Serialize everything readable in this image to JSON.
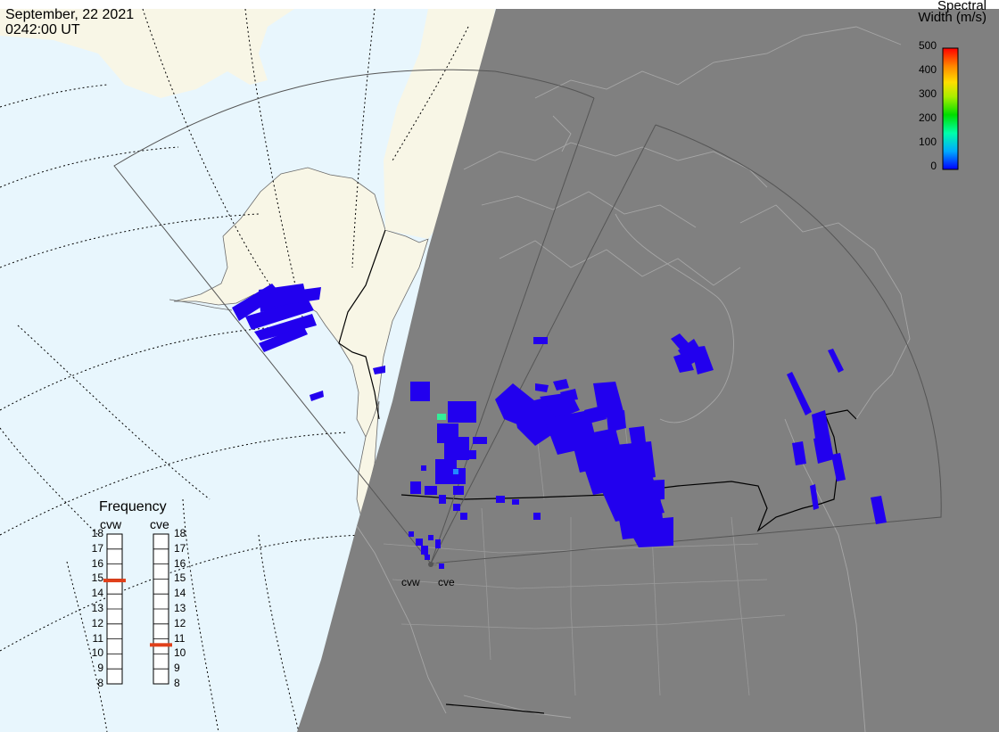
{
  "header": {
    "date": "September, 22 2021",
    "time": "0242:00 UT"
  },
  "colorbar": {
    "title_line1": "Spectral",
    "title_line2": "Width (m/s)",
    "ticks": [
      "500",
      "400",
      "300",
      "200",
      "100",
      "0"
    ],
    "colors": [
      "#0000ff",
      "#00aaff",
      "#00ffaa",
      "#00dd00",
      "#aaee00",
      "#ffdd00",
      "#ff8800",
      "#ff0000"
    ]
  },
  "frequency_panel": {
    "title": "Frequency",
    "radars": [
      {
        "name": "cvw",
        "marker_mhz": 14.9,
        "ticks": [
          "18",
          "17",
          "16",
          "15",
          "14",
          "13",
          "12",
          "11",
          "10",
          "9",
          "8"
        ]
      },
      {
        "name": "cve",
        "marker_mhz": 10.6,
        "ticks": [
          "18",
          "17",
          "16",
          "15",
          "14",
          "13",
          "12",
          "11",
          "10",
          "9",
          "8"
        ]
      }
    ],
    "marker_color": "#e0401a"
  },
  "sites": [
    {
      "name": "cvw"
    },
    {
      "name": "cve"
    }
  ],
  "colors": {
    "ocean": "#e8f6fd",
    "land": "#f8f6e6",
    "night": "#808080",
    "scatter": "#2200ee",
    "scatter_high": "#33ee99"
  }
}
